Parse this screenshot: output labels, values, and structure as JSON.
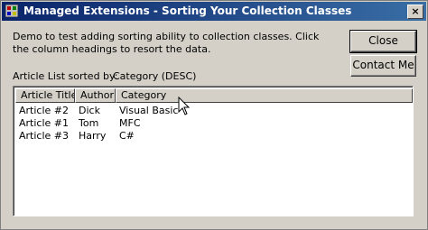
{
  "window": {
    "title": "Managed Extensions - Sorting Your Collection Classes",
    "close_glyph": "×"
  },
  "description": "Demo to test adding sorting ability to collection classes. Click the column headings to resort the data.",
  "sort_status": {
    "label": "Article List sorted by:",
    "value": "Category (DESC)"
  },
  "buttons": {
    "close_label": "Close",
    "contact_label": "Contact Me"
  },
  "list": {
    "columns": [
      "Article Title",
      "Author",
      "Category"
    ],
    "rows": [
      [
        "Article #2",
        "Dick",
        "Visual Basic"
      ],
      [
        "Article #1",
        "Tom",
        "MFC"
      ],
      [
        "Article #3",
        "Harry",
        "C#"
      ]
    ]
  }
}
